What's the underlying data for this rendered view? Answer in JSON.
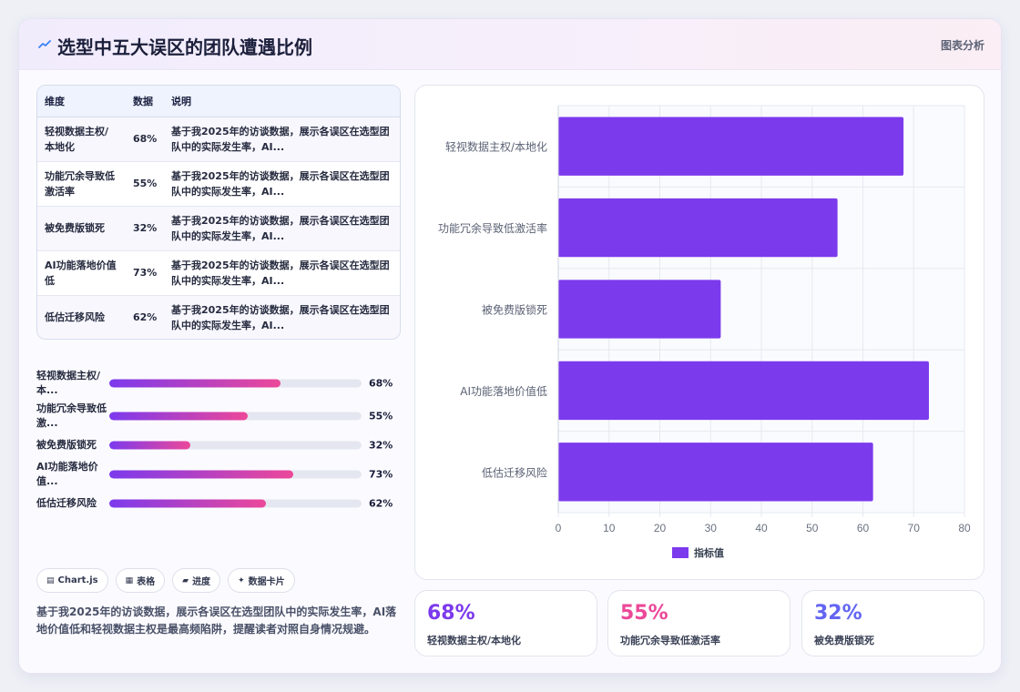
{
  "header": {
    "title": "选型中五大误区的团队遭遇比例",
    "right_label": "图表分析",
    "icon": "chart-trend-icon"
  },
  "table": {
    "columns": [
      "维度",
      "数据",
      "说明"
    ],
    "rows": [
      {
        "name": "轻视数据主权/本地化",
        "value": "68%",
        "desc": "基于我2025年的访谈数据，展示各误区在选型团队中的实际发生率，AI..."
      },
      {
        "name": "功能冗余导致低激活率",
        "value": "55%",
        "desc": "基于我2025年的访谈数据，展示各误区在选型团队中的实际发生率，AI..."
      },
      {
        "name": "被免费版锁死",
        "value": "32%",
        "desc": "基于我2025年的访谈数据，展示各误区在选型团队中的实际发生率，AI..."
      },
      {
        "name": "AI功能落地价值低",
        "value": "73%",
        "desc": "基于我2025年的访谈数据，展示各误区在选型团队中的实际发生率，AI..."
      },
      {
        "name": "低估迁移风险",
        "value": "62%",
        "desc": "基于我2025年的访谈数据，展示各误区在选型团队中的实际发生率，AI..."
      }
    ]
  },
  "progress": [
    {
      "label": "轻视数据主权/本...",
      "value": "68%",
      "fraction": 0.68
    },
    {
      "label": "功能冗余导致低激...",
      "value": "55%",
      "fraction": 0.55
    },
    {
      "label": "被免费版锁死",
      "value": "32%",
      "fraction": 0.32
    },
    {
      "label": "AI功能落地价值...",
      "value": "73%",
      "fraction": 0.73
    },
    {
      "label": "低估迁移风险",
      "value": "62%",
      "fraction": 0.62
    }
  ],
  "chips": [
    {
      "icon": "bar-chart-icon",
      "glyph": "▤",
      "label": "Chart.js"
    },
    {
      "icon": "table-icon",
      "glyph": "▦",
      "label": "表格"
    },
    {
      "icon": "progress-icon",
      "glyph": "▰",
      "label": "进度"
    },
    {
      "icon": "sparkle-icon",
      "glyph": "✦",
      "label": "数据卡片"
    }
  ],
  "summary": "基于我2025年的访谈数据，展示各误区在选型团队中的实际发生率，AI落地价值低和轻视数据主权是最高频陷阱，提醒读者对照自身情况规避。",
  "stats": [
    {
      "value": "68%",
      "label": "轻视数据主权/本地化",
      "color": "#7c3aed"
    },
    {
      "value": "55%",
      "label": "功能冗余导致低激活率",
      "color": "#ec4899"
    },
    {
      "value": "32%",
      "label": "被免费版锁死",
      "color": "#6366f1"
    }
  ],
  "colors": {
    "accent": "#7c3aed",
    "bar": "#7c3aed",
    "pink": "#ec4899",
    "indigo": "#6366f1"
  },
  "chart_data": {
    "type": "bar",
    "orientation": "horizontal",
    "categories": [
      "轻视数据主权/本地化",
      "功能冗余导致低激活率",
      "被免费版锁死",
      "AI功能落地价值低",
      "低估迁移风险"
    ],
    "series": [
      {
        "name": "指标值",
        "values": [
          68,
          55,
          32,
          73,
          62
        ]
      }
    ],
    "xlim": [
      0,
      80
    ],
    "xticks": [
      0,
      10,
      20,
      30,
      40,
      50,
      60,
      70,
      80
    ],
    "grid": true,
    "legend": "bottom"
  }
}
